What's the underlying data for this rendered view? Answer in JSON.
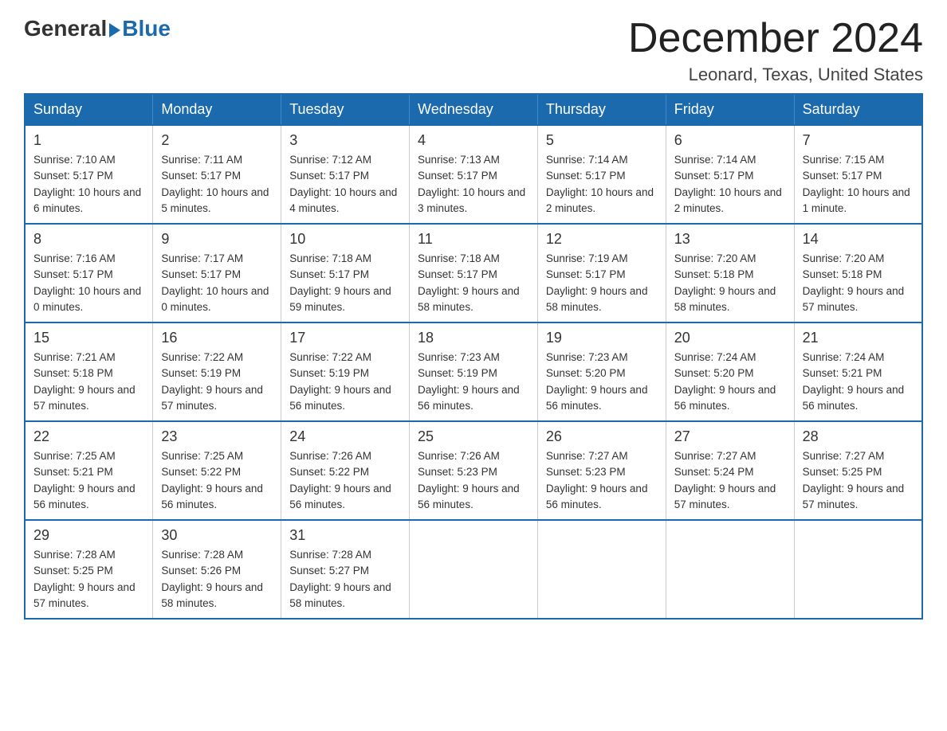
{
  "logo": {
    "general": "General",
    "blue": "Blue"
  },
  "title": "December 2024",
  "location": "Leonard, Texas, United States",
  "days_of_week": [
    "Sunday",
    "Monday",
    "Tuesday",
    "Wednesday",
    "Thursday",
    "Friday",
    "Saturday"
  ],
  "weeks": [
    [
      {
        "day": "1",
        "sunrise": "7:10 AM",
        "sunset": "5:17 PM",
        "daylight": "10 hours and 6 minutes."
      },
      {
        "day": "2",
        "sunrise": "7:11 AM",
        "sunset": "5:17 PM",
        "daylight": "10 hours and 5 minutes."
      },
      {
        "day": "3",
        "sunrise": "7:12 AM",
        "sunset": "5:17 PM",
        "daylight": "10 hours and 4 minutes."
      },
      {
        "day": "4",
        "sunrise": "7:13 AM",
        "sunset": "5:17 PM",
        "daylight": "10 hours and 3 minutes."
      },
      {
        "day": "5",
        "sunrise": "7:14 AM",
        "sunset": "5:17 PM",
        "daylight": "10 hours and 2 minutes."
      },
      {
        "day": "6",
        "sunrise": "7:14 AM",
        "sunset": "5:17 PM",
        "daylight": "10 hours and 2 minutes."
      },
      {
        "day": "7",
        "sunrise": "7:15 AM",
        "sunset": "5:17 PM",
        "daylight": "10 hours and 1 minute."
      }
    ],
    [
      {
        "day": "8",
        "sunrise": "7:16 AM",
        "sunset": "5:17 PM",
        "daylight": "10 hours and 0 minutes."
      },
      {
        "day": "9",
        "sunrise": "7:17 AM",
        "sunset": "5:17 PM",
        "daylight": "10 hours and 0 minutes."
      },
      {
        "day": "10",
        "sunrise": "7:18 AM",
        "sunset": "5:17 PM",
        "daylight": "9 hours and 59 minutes."
      },
      {
        "day": "11",
        "sunrise": "7:18 AM",
        "sunset": "5:17 PM",
        "daylight": "9 hours and 58 minutes."
      },
      {
        "day": "12",
        "sunrise": "7:19 AM",
        "sunset": "5:17 PM",
        "daylight": "9 hours and 58 minutes."
      },
      {
        "day": "13",
        "sunrise": "7:20 AM",
        "sunset": "5:18 PM",
        "daylight": "9 hours and 58 minutes."
      },
      {
        "day": "14",
        "sunrise": "7:20 AM",
        "sunset": "5:18 PM",
        "daylight": "9 hours and 57 minutes."
      }
    ],
    [
      {
        "day": "15",
        "sunrise": "7:21 AM",
        "sunset": "5:18 PM",
        "daylight": "9 hours and 57 minutes."
      },
      {
        "day": "16",
        "sunrise": "7:22 AM",
        "sunset": "5:19 PM",
        "daylight": "9 hours and 57 minutes."
      },
      {
        "day": "17",
        "sunrise": "7:22 AM",
        "sunset": "5:19 PM",
        "daylight": "9 hours and 56 minutes."
      },
      {
        "day": "18",
        "sunrise": "7:23 AM",
        "sunset": "5:19 PM",
        "daylight": "9 hours and 56 minutes."
      },
      {
        "day": "19",
        "sunrise": "7:23 AM",
        "sunset": "5:20 PM",
        "daylight": "9 hours and 56 minutes."
      },
      {
        "day": "20",
        "sunrise": "7:24 AM",
        "sunset": "5:20 PM",
        "daylight": "9 hours and 56 minutes."
      },
      {
        "day": "21",
        "sunrise": "7:24 AM",
        "sunset": "5:21 PM",
        "daylight": "9 hours and 56 minutes."
      }
    ],
    [
      {
        "day": "22",
        "sunrise": "7:25 AM",
        "sunset": "5:21 PM",
        "daylight": "9 hours and 56 minutes."
      },
      {
        "day": "23",
        "sunrise": "7:25 AM",
        "sunset": "5:22 PM",
        "daylight": "9 hours and 56 minutes."
      },
      {
        "day": "24",
        "sunrise": "7:26 AM",
        "sunset": "5:22 PM",
        "daylight": "9 hours and 56 minutes."
      },
      {
        "day": "25",
        "sunrise": "7:26 AM",
        "sunset": "5:23 PM",
        "daylight": "9 hours and 56 minutes."
      },
      {
        "day": "26",
        "sunrise": "7:27 AM",
        "sunset": "5:23 PM",
        "daylight": "9 hours and 56 minutes."
      },
      {
        "day": "27",
        "sunrise": "7:27 AM",
        "sunset": "5:24 PM",
        "daylight": "9 hours and 57 minutes."
      },
      {
        "day": "28",
        "sunrise": "7:27 AM",
        "sunset": "5:25 PM",
        "daylight": "9 hours and 57 minutes."
      }
    ],
    [
      {
        "day": "29",
        "sunrise": "7:28 AM",
        "sunset": "5:25 PM",
        "daylight": "9 hours and 57 minutes."
      },
      {
        "day": "30",
        "sunrise": "7:28 AM",
        "sunset": "5:26 PM",
        "daylight": "9 hours and 58 minutes."
      },
      {
        "day": "31",
        "sunrise": "7:28 AM",
        "sunset": "5:27 PM",
        "daylight": "9 hours and 58 minutes."
      },
      null,
      null,
      null,
      null
    ]
  ]
}
